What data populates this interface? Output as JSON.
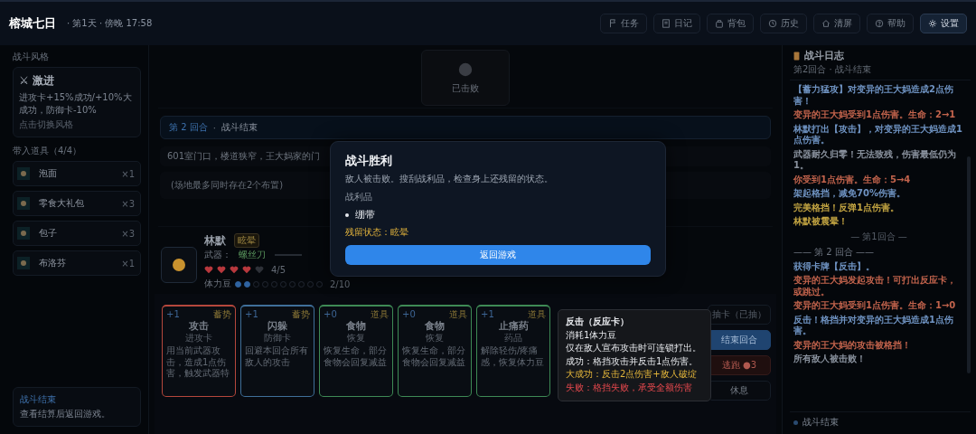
{
  "header": {
    "title": "榕城七日",
    "meta": "· 第1天 · 傍晚 17:58"
  },
  "nav": [
    {
      "label": "任务",
      "selected": false
    },
    {
      "label": "日记",
      "selected": false
    },
    {
      "label": "背包",
      "selected": false
    },
    {
      "label": "历史",
      "selected": false
    },
    {
      "label": "清屏",
      "selected": false
    },
    {
      "label": "帮助",
      "selected": false
    },
    {
      "label": "设置",
      "selected": true
    }
  ],
  "sidebar": {
    "style_heading": "战斗风格",
    "style": {
      "icon": "⚔",
      "name": "激进",
      "desc": "进攻卡+15%成功/+10%大成功，防御卡-10%",
      "hint": "点击切换风格"
    },
    "items_heading": "带入道具（4/4）",
    "items": [
      {
        "name": "泡面",
        "count": "×1"
      },
      {
        "name": "零食大礼包",
        "count": "×3"
      },
      {
        "name": "包子",
        "count": "×3"
      },
      {
        "name": "布洛芬",
        "count": "×1"
      }
    ],
    "footer": {
      "title": "战斗结束",
      "text": "查看结算后返回游戏。"
    }
  },
  "enemy": {
    "status": "已击败"
  },
  "round": {
    "label": "第 2 回合",
    "sep": "·",
    "state": "战斗结束"
  },
  "scene": "601室门口，楼道狭窄，王大妈家的门",
  "note": "(场地最多同时存在2个布置)",
  "player": {
    "name": "林默",
    "status": "眩晕",
    "weapon_label": "武器：",
    "weapon": "螺丝刀",
    "hearts": {
      "stars": 4,
      "reading": "4/5"
    },
    "stamina_label": "体力豆",
    "stamina": {
      "stars": 2,
      "reading": "2/10"
    }
  },
  "cards": [
    {
      "cost": "+1",
      "tag": "蓄势",
      "name": "攻击",
      "type": "进攻卡",
      "desc": "用当前武器攻击，造成1点伤害，触发武器特",
      "color": "#b5473c"
    },
    {
      "cost": "+1",
      "tag": "蓄势",
      "name": "闪躲",
      "type": "防御卡",
      "desc": "回避本回合所有敌人的攻击",
      "color": "#3f6f99"
    },
    {
      "cost": "+0",
      "tag": "道具",
      "name": "食物",
      "type": "恢复",
      "desc": "恢复生命，部分食物会回复减益",
      "color": "#3e8a55"
    },
    {
      "cost": "+0",
      "tag": "道具",
      "name": "食物",
      "type": "恢复",
      "desc": "恢复生命，部分食物会回复减益",
      "color": "#3e8a55"
    },
    {
      "cost": "+1",
      "tag": "道具",
      "name": "止痛药",
      "type": "药品",
      "desc": "解除轻伤/疼痛感，恢复体力豆",
      "color": "#3e8a55"
    }
  ],
  "actions": [
    {
      "kind": "disabled",
      "label": "抽卡（已抽）"
    },
    {
      "kind": "primary",
      "label": "结束回合"
    },
    {
      "kind": "danger",
      "label": "逃跑 ●3"
    },
    {
      "kind": "plain",
      "label": "休息"
    }
  ],
  "log": {
    "title": "战斗日志",
    "subtitle": "第2回合 · 战斗结束",
    "entries": [
      {
        "kind": "entry",
        "text": "【蓄力猛攻】对变异的王大妈造成2点伤害！",
        "color": "#6f93c2"
      },
      {
        "kind": "entry",
        "text": "变异的王大妈受到1点伤害。生命：2→1",
        "color": "#c2634c"
      },
      {
        "kind": "entry",
        "text": "林默打出【攻击】，对变异的王大妈造成1点伤害。",
        "color": "#6f93c2"
      },
      {
        "kind": "entry",
        "text": "武器耐久归零！无法致残，伤害最低仍为1。",
        "color": "#8a929e"
      },
      {
        "kind": "entry",
        "text": "你受到1点伤害。生命：5→4",
        "color": "#c2634c"
      },
      {
        "kind": "entry",
        "text": "架起格挡，减免70%伤害。",
        "color": "#6f93c2"
      },
      {
        "kind": "entry",
        "text": "完美格挡！反弹1点伤害。",
        "color": "#c4a542"
      },
      {
        "kind": "entry",
        "text": "林默被震晕！",
        "color": "#c4a542"
      },
      {
        "kind": "minor",
        "text": "— 第1回合 —"
      },
      {
        "kind": "divider",
        "text": "—— 第 2 回合 ——"
      },
      {
        "kind": "entry",
        "text": "获得卡牌【反击】。",
        "color": "#6f93c2"
      },
      {
        "kind": "entry",
        "text": "变异的王大妈发起攻击！可打出反应卡，或跳过。",
        "color": "#c2634c"
      },
      {
        "kind": "entry",
        "text": "变异的王大妈受到1点伤害。生命：1→0",
        "color": "#c2634c"
      },
      {
        "kind": "entry",
        "text": "反击！格挡并对变异的王大妈造成1点伤害。",
        "color": "#6f93c2"
      },
      {
        "kind": "entry",
        "text": "变异的王大妈的攻击被格挡！",
        "color": "#c2634c"
      },
      {
        "kind": "entry",
        "text": "所有敌人被击败！",
        "color": "#8a929e"
      }
    ],
    "footer": "战斗结束"
  },
  "modal": {
    "title": "战斗胜利",
    "text": "敌人被击败。搜刮战利品，检查身上还残留的状态。",
    "loot_heading": "战利品",
    "loot": [
      "绷带"
    ],
    "residual_label": "残留状态：",
    "residual": "眩晕",
    "button": "返回游戏"
  },
  "tooltip": {
    "title": "反击（反应卡）",
    "lines": [
      {
        "kind": "plain",
        "text": "消耗1体力豆"
      },
      {
        "kind": "plain",
        "text": "仅在敌人宣布攻击时可连锁打出。"
      },
      {
        "kind": "plain",
        "text": "成功：格挡攻击并反击1点伤害。"
      },
      {
        "kind": "great",
        "text": "大成功：反击2点伤害+敌人破绽"
      },
      {
        "kind": "fail",
        "text": "失败：格挡失败，承受全额伤害"
      }
    ]
  }
}
